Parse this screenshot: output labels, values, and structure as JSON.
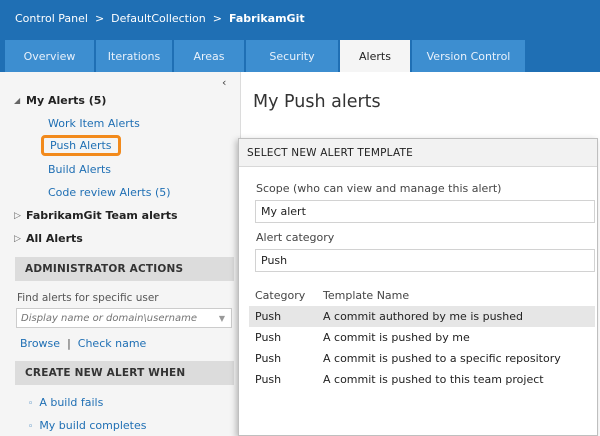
{
  "breadcrumb": {
    "items": [
      "Control Panel",
      "DefaultCollection",
      "FabrikamGit"
    ],
    "separator": ">"
  },
  "tabs": [
    {
      "label": "Overview",
      "active": false
    },
    {
      "label": "Iterations",
      "active": false
    },
    {
      "label": "Areas",
      "active": false
    },
    {
      "label": "Security",
      "active": false
    },
    {
      "label": "Alerts",
      "active": true
    },
    {
      "label": "Version Control",
      "active": false
    }
  ],
  "sidebar": {
    "collapse_glyph": "‹",
    "my_alerts": {
      "label": "My Alerts (5)",
      "toggle": "◢",
      "children": [
        "Work Item Alerts",
        "Push Alerts",
        "Build Alerts",
        "Code review Alerts (5)"
      ],
      "selected": "Push Alerts"
    },
    "team_alerts": {
      "label": "FabrikamGit Team alerts",
      "toggle": "▷"
    },
    "all_alerts": {
      "label": "All Alerts",
      "toggle": "▷"
    },
    "admin_actions": {
      "header": "ADMINISTRATOR ACTIONS",
      "find_label": "Find alerts for specific user",
      "find_placeholder": "Display name or domain\\username",
      "dropdown_glyph": "▼",
      "browse": "Browse",
      "pipe": "|",
      "check_name": "Check name"
    },
    "create_new": {
      "header": "CREATE NEW ALERT WHEN",
      "bullet": "◦",
      "items": [
        "A build fails",
        "My build completes"
      ]
    }
  },
  "main": {
    "title": "My Push alerts"
  },
  "dialog": {
    "title": "SELECT NEW ALERT TEMPLATE",
    "scope_label": "Scope (who can view and manage this alert)",
    "scope_value": "My alert",
    "category_label": "Alert category",
    "category_value": "Push",
    "columns": [
      "Category",
      "Template Name"
    ],
    "rows": [
      {
        "category": "Push",
        "name": "A commit authored by me is pushed",
        "selected": true
      },
      {
        "category": "Push",
        "name": "A commit is pushed by me",
        "selected": false
      },
      {
        "category": "Push",
        "name": "A commit is pushed to a specific repository",
        "selected": false
      },
      {
        "category": "Push",
        "name": "A commit is pushed to this team project",
        "selected": false
      }
    ]
  },
  "colors": {
    "header_blue": "#1f6fb4",
    "tab_blue": "#3d8ed0",
    "highlight_orange": "#f28a1c",
    "link_blue": "#1f6fb4"
  }
}
